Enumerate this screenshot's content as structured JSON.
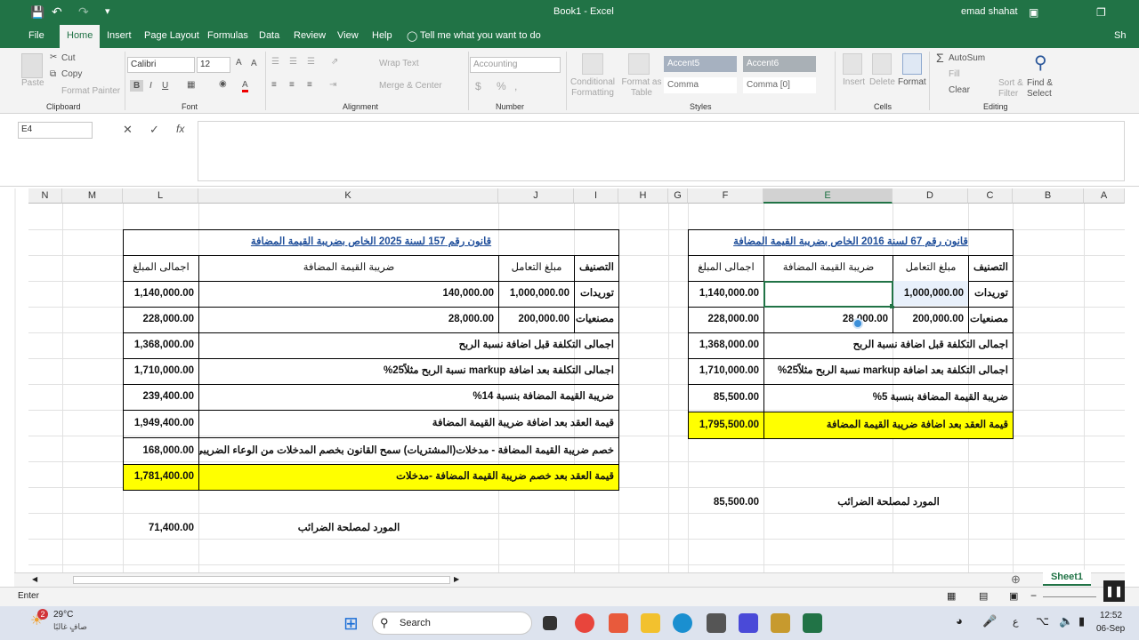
{
  "window": {
    "title": "Book1 - Excel",
    "user": "emad shahat"
  },
  "ribbon_tabs": [
    "File",
    "Home",
    "Insert",
    "Page Layout",
    "Formulas",
    "Data",
    "Review",
    "View",
    "Help"
  ],
  "tell_me": "Tell me what you want to do",
  "share": "Sh",
  "clipboard": {
    "paste": "Paste",
    "cut": "Cut",
    "copy": "Copy",
    "format_painter": "Format Painter",
    "label": "Clipboard"
  },
  "font": {
    "name": "Calibri",
    "size": "12",
    "label": "Font"
  },
  "alignment": {
    "wrap_text": "Wrap Text",
    "merge_center": "Merge & Center",
    "label": "Alignment"
  },
  "number": {
    "format": "Accounting",
    "label": "Number"
  },
  "styles": {
    "conditional": "Conditional Formatting",
    "format_as_table": "Format as Table",
    "cells": [
      "Accent5",
      "Accent6",
      "Comma",
      "Comma [0]"
    ],
    "label": "Styles"
  },
  "cells_group": {
    "insert": "Insert",
    "delete": "Delete",
    "format": "Format",
    "label": "Cells"
  },
  "editing": {
    "autosum": "AutoSum",
    "fill": "Fill",
    "clear": "Clear",
    "sort_filter": "Sort & Filter",
    "find_select": "Find & Select",
    "label": "Editing"
  },
  "formula_bar": {
    "name_box": "E4",
    "formula": ""
  },
  "columns": [
    "N",
    "M",
    "L",
    "K",
    "J",
    "I",
    "H",
    "G",
    "F",
    "E",
    "D",
    "C",
    "B",
    "A"
  ],
  "left_table": {
    "title": "قانون رقم 157 لسنة 2025 الخاص بضريبة  القيمة المضافة",
    "headers": {
      "category": "التصنيف",
      "amount": "مبلغ التعامل",
      "vat": "ضريبة القيمة المضافة",
      "total": "اجمالى المبلغ"
    },
    "rows": [
      {
        "category": "توريدات",
        "amount": "1,000,000.00",
        "vat": "140,000.00",
        "total": "1,140,000.00"
      },
      {
        "category": "مصنعيات",
        "amount": "200,000.00",
        "vat": "28,000.00",
        "total": "228,000.00"
      }
    ],
    "summary": [
      {
        "label": "اجمالى التكلفة قبل اضافة نسبة الربح",
        "value": "1,368,000.00"
      },
      {
        "label": "اجمالى التكلفة بعد اضافة markup نسبة الربح مثلاً25%",
        "value": "1,710,000.00"
      },
      {
        "label": "ضريبة القيمة المضافة بنسبة 14%",
        "value": "239,400.00"
      },
      {
        "label": "قيمة العقد بعد اضافة ضريبة القيمة المضافة",
        "value": "1,949,400.00"
      },
      {
        "label": "خصم ضريبة القيمة المضافة - مدخلات(المشتريات) سمح القانون بخصم المدخلات من الوعاء الضريبى",
        "value": "168,000.00"
      },
      {
        "label": "قيمة العقد بعد خصم ضريبة القيمة المضافة -مدخلات",
        "value": "1,781,400.00"
      }
    ],
    "supplier_label": "المورد لمصلحة الضرائب",
    "supplier_value": "71,400.00"
  },
  "right_table": {
    "title": "قانون رقم 67 لسنة 2016 الخاص بضريبة  القيمة المضافة",
    "headers": {
      "category": "التصنيف",
      "amount": "مبلغ التعامل",
      "vat": "ضريبة القيمة المضافة",
      "total": "اجمالى المبلغ"
    },
    "rows": [
      {
        "category": "توريدات",
        "amount": "1,000,000.00",
        "vat": "",
        "total": "1,140,000.00"
      },
      {
        "category": "مصنعيات",
        "amount": "200,000.00",
        "vat": "28,000.00",
        "total": "228,000.00"
      }
    ],
    "summary": [
      {
        "label": "اجمالى التكلفة قبل اضافة نسبة الربح",
        "value": "1,368,000.00"
      },
      {
        "label": "اجمالى التكلفة بعد اضافة markup نسبة الربح مثلاً25%",
        "value": "1,710,000.00"
      },
      {
        "label": "ضريبة القيمة المضافة بنسبة 5%",
        "value": "85,500.00"
      },
      {
        "label": "قيمة العقد بعد اضافة ضريبة القيمة المضافة",
        "value": "1,795,500.00"
      }
    ],
    "supplier_label": "المورد لمصلحة الضرائب",
    "supplier_value": "85,500.00"
  },
  "sheet_tab": "Sheet1",
  "status": {
    "mode": "Enter"
  },
  "taskbar": {
    "temp": "29°C",
    "weather": "صافٍ غالبًا",
    "search": "Search",
    "time": "12:52",
    "date": "06-Sep",
    "lang": "ع",
    "badge": "2"
  },
  "colors": {
    "excel_green": "#217346",
    "highlight": "#ffff00",
    "title_blue": "#1f4e9a"
  }
}
